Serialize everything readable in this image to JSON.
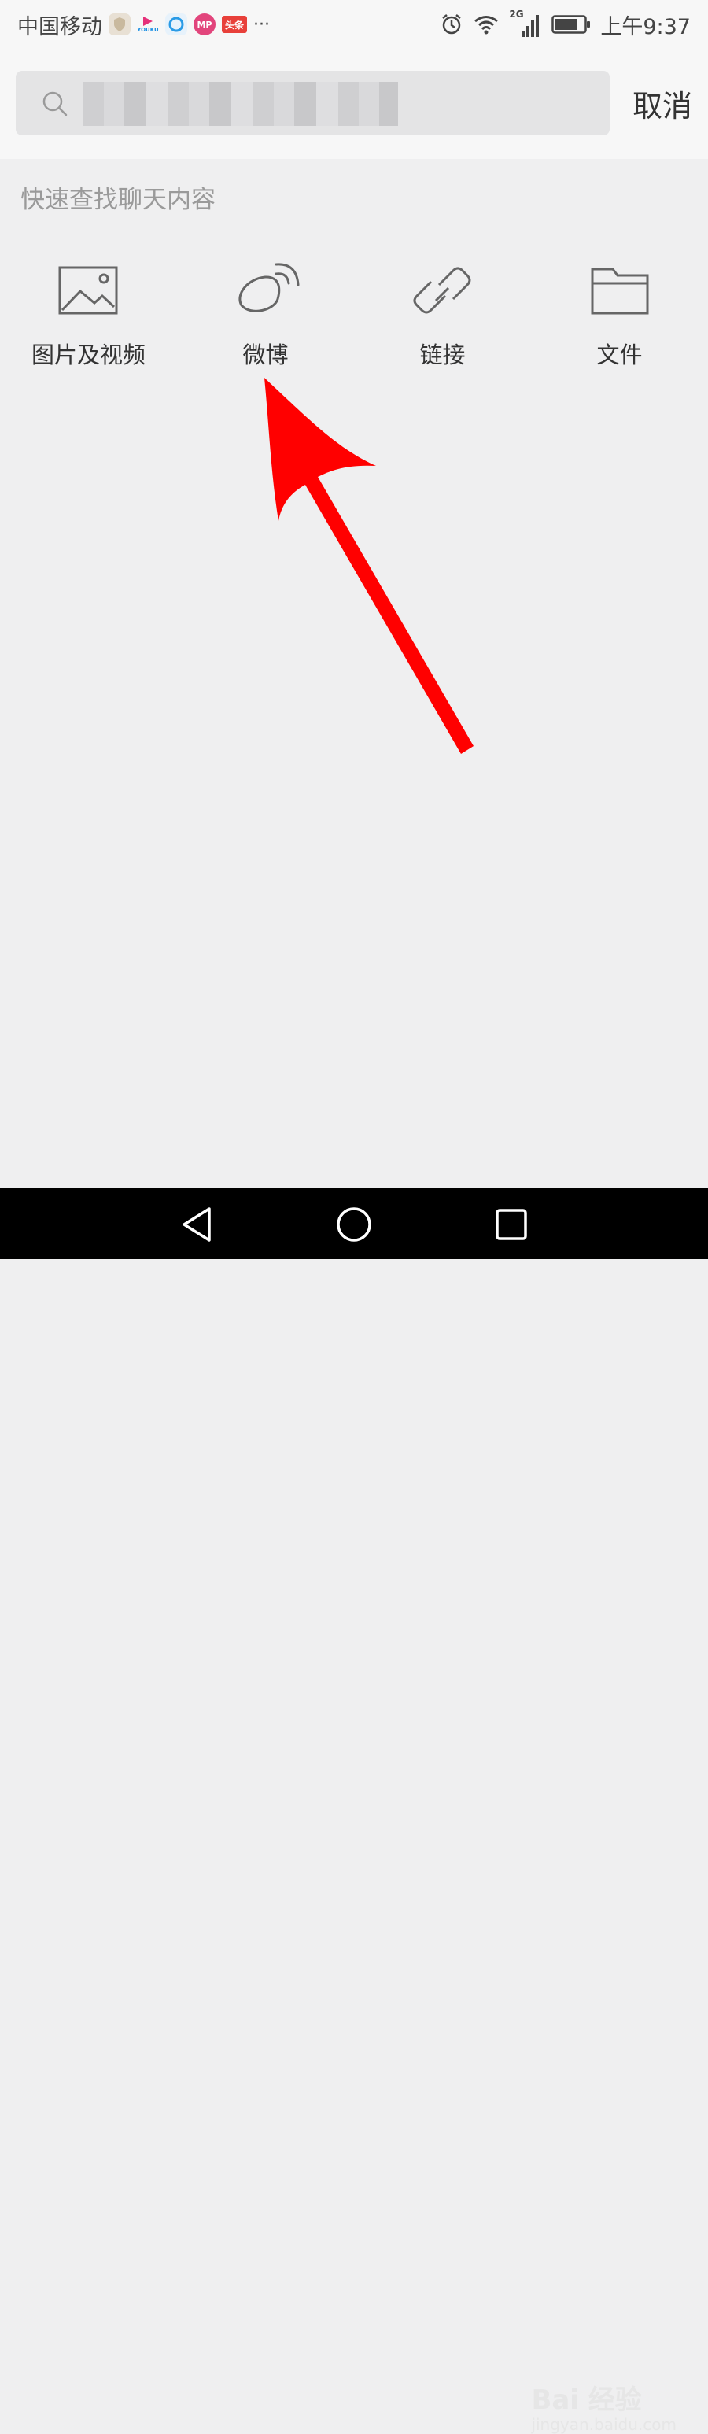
{
  "status_bar": {
    "carrier": "中国移动",
    "network": "2G",
    "time": "上午9:37",
    "app_icons": [
      {
        "name": "shield-app-icon",
        "text": ""
      },
      {
        "name": "youku-app-icon",
        "text": "YOUKU"
      },
      {
        "name": "browser-app-icon",
        "text": ""
      },
      {
        "name": "mp-app-icon",
        "text": "MP"
      },
      {
        "name": "toutiao-app-icon",
        "text": "头条"
      }
    ],
    "more": "···"
  },
  "search": {
    "placeholder": "",
    "cancel_label": "取消"
  },
  "hint": "快速查找聊天内容",
  "categories": [
    {
      "label": "图片及视频",
      "icon": "image-icon"
    },
    {
      "label": "微博",
      "icon": "weibo-icon"
    },
    {
      "label": "链接",
      "icon": "link-icon"
    },
    {
      "label": "文件",
      "icon": "folder-icon"
    }
  ],
  "watermark": {
    "brand": "Bai 经验",
    "url": "jingyan.baidu.com"
  },
  "colors": {
    "arrow": "#ff0000",
    "background": "#efeff0",
    "icon": "#666666"
  }
}
